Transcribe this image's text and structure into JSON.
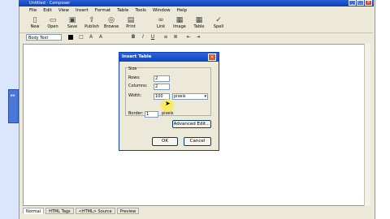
{
  "window": {
    "title": "Untitled - Composer"
  },
  "menu": [
    "File",
    "Edit",
    "View",
    "Insert",
    "Format",
    "Table",
    "Tools",
    "Window",
    "Help"
  ],
  "toolbar": [
    {
      "label": "New",
      "icon": "new-page-icon"
    },
    {
      "label": "Open",
      "icon": "folder-icon"
    },
    {
      "label": "Save",
      "icon": "disk-icon"
    },
    {
      "label": "Publish",
      "icon": "publish-icon"
    },
    {
      "label": "Browse",
      "icon": "globe-icon"
    },
    {
      "label": "Print",
      "icon": "printer-icon"
    },
    {
      "label": "Link",
      "icon": "chain-icon"
    },
    {
      "label": "Image",
      "icon": "picture-icon"
    },
    {
      "label": "Table",
      "icon": "grid-icon"
    },
    {
      "label": "Spell",
      "icon": "spellcheck-icon"
    }
  ],
  "format": {
    "style_select": "Body Text"
  },
  "tabs": [
    "Normal",
    "HTML Tags",
    "<HTML> Source",
    "Preview"
  ],
  "dialog": {
    "title": "Insert Table",
    "group_label": "Size",
    "rows_label": "Rows:",
    "rows_value": "2",
    "columns_label": "Columns:",
    "columns_value": "2",
    "width_label": "Width:",
    "width_value": "100",
    "width_unit": "pixels",
    "border_label": "Border:",
    "border_value": "1",
    "border_unit": "pixels",
    "advanced_label": "Advanced Edit...",
    "ok_label": "OK",
    "cancel_label": "Cancel"
  }
}
